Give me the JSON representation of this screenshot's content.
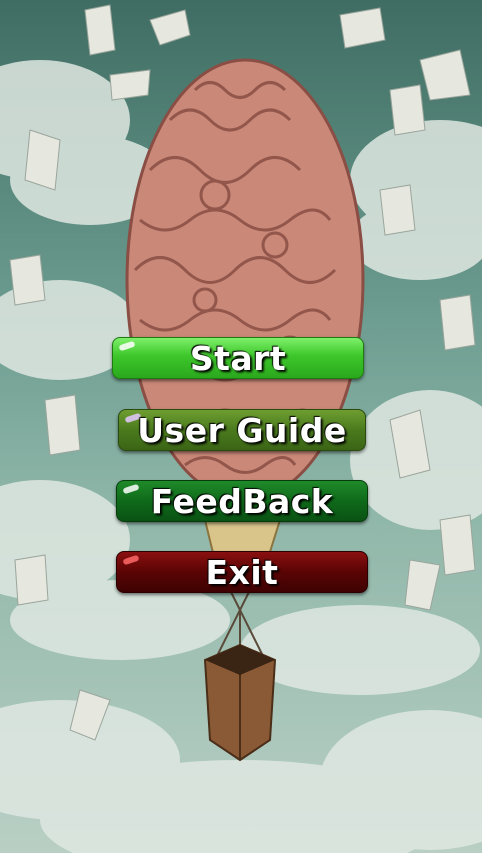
{
  "menu": {
    "start_label": "Start",
    "guide_label": "User Guide",
    "feedback_label": "FeedBack",
    "exit_label": "Exit"
  },
  "background": {
    "description_icon": "brain-hot-air-balloon-illustration",
    "colors": {
      "sky": "#6a9a8e",
      "brain": "#c98878",
      "start": "#3dc62a",
      "guide": "#4a7a1d",
      "feedback": "#0f6a1a",
      "exit": "#5a0404"
    }
  }
}
